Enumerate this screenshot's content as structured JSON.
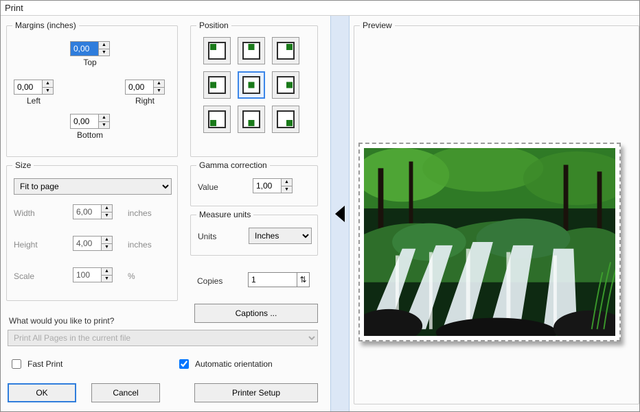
{
  "window": {
    "title": "Print"
  },
  "margins": {
    "legend": "Margins (inches)",
    "top": {
      "label": "Top",
      "value": "0,00"
    },
    "left": {
      "label": "Left",
      "value": "0,00"
    },
    "right": {
      "label": "Right",
      "value": "0,00"
    },
    "bottom": {
      "label": "Bottom",
      "value": "0,00"
    }
  },
  "position": {
    "legend": "Position",
    "selected": "mc",
    "cells": [
      "tl",
      "tc",
      "tr",
      "ml",
      "mc",
      "mr",
      "bl",
      "bc",
      "br"
    ]
  },
  "size": {
    "legend": "Size",
    "mode": "Fit to page",
    "width": {
      "label": "Width",
      "value": "6,00",
      "unit": "inches"
    },
    "height": {
      "label": "Height",
      "value": "4,00",
      "unit": "inches"
    },
    "scale": {
      "label": "Scale",
      "value": "100",
      "unit": "%"
    }
  },
  "gamma": {
    "legend": "Gamma correction",
    "value_label": "Value",
    "value": "1,00"
  },
  "units": {
    "legend": "Measure units",
    "label": "Units",
    "value": "Inches"
  },
  "copies": {
    "label": "Copies",
    "value": "1"
  },
  "captions": {
    "label": "Captions ..."
  },
  "print_what": {
    "label": "What would you like to print?",
    "value": "Print All Pages in the current file"
  },
  "fast_print": {
    "label": "Fast Print",
    "checked": false
  },
  "auto_orient": {
    "label": "Automatic orientation",
    "checked": true
  },
  "buttons": {
    "ok": "OK",
    "cancel": "Cancel",
    "printer_setup": "Printer Setup"
  },
  "preview": {
    "legend": "Preview"
  }
}
